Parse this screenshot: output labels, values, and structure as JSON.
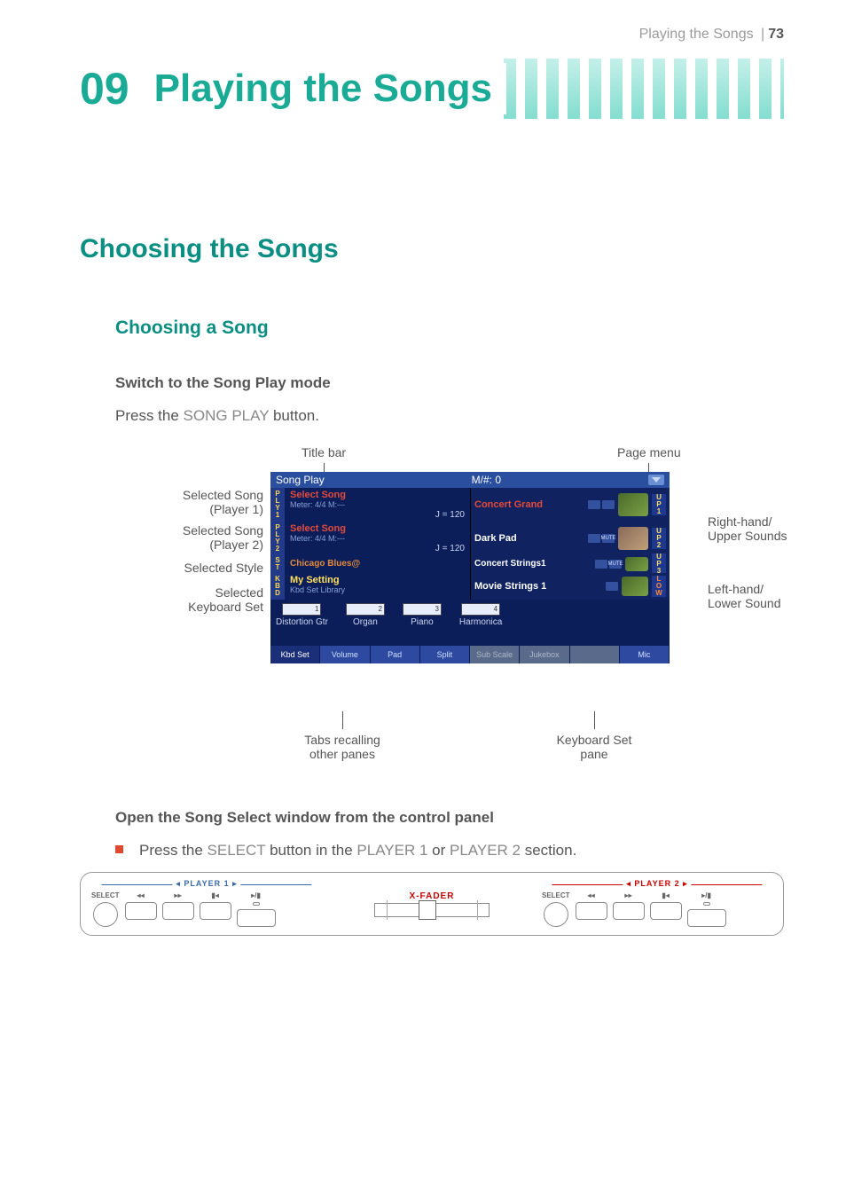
{
  "pageHeader": {
    "section": "Playing the Songs",
    "page": "73"
  },
  "chapter": {
    "num": "09",
    "title": "Playing the Songs"
  },
  "section": "Choosing the Songs",
  "subsection": "Choosing a Song",
  "lead1": "Switch to the Song Play mode",
  "para1a": "Press the ",
  "para1b": "SONG PLAY",
  "para1c": " button.",
  "callouts": {
    "titleBar": "Title bar",
    "pageMenu": "Page menu",
    "selSongP1a": "Selected Song",
    "selSongP1b": "(Player 1)",
    "selSongP2a": "Selected Song",
    "selSongP2b": "(Player 2)",
    "selStyle": "Selected Style",
    "selKbdA": "Selected",
    "selKbdB": "Keyboard Set",
    "rhA": "Right-hand/",
    "rhB": "Upper Sounds",
    "lhA": "Left-hand/",
    "lhB": "Lower Sound",
    "tabsA": "Tabs recalling",
    "tabsB": "other panes",
    "kbdPaneA": "Keyboard Set",
    "kbdPaneB": "pane"
  },
  "screen": {
    "title": "Song Play",
    "counter": "M/#: 0",
    "ply1": {
      "side": "PLY1",
      "title": "Select Song",
      "meter": "Meter: 4/4    M:---",
      "tempo": "J = 120"
    },
    "ply2": {
      "side": "PLY2",
      "title": "Select Song",
      "meter": "Meter: 4/4    M:---",
      "tempo": "J = 120"
    },
    "style": {
      "side": "ST",
      "name": "Chicago Blues@"
    },
    "kbdset": {
      "side": "KBD",
      "title": "My Setting",
      "sub": "Kbd Set Library"
    },
    "sounds": {
      "up1": "Concert Grand",
      "up1tag": "UP1",
      "up2": "Dark Pad",
      "up2tag": "UP2",
      "mute": "MUTE",
      "up3": "Concert Strings1",
      "up3tag": "UP3",
      "low": "Movie Strings 1",
      "lowtag": "LOW"
    },
    "kbdItems": {
      "k1n": "1",
      "k1": "Distortion Gtr",
      "k2n": "2",
      "k2": "Organ",
      "k3n": "3",
      "k3": "Piano",
      "k4n": "4",
      "k4": "Harmonica"
    },
    "tabs": {
      "t1": "Kbd Set",
      "t2": "Volume",
      "t3": "Pad",
      "t4": "Split",
      "t5": "Sub Scale",
      "t6": "Jukebox",
      "t7": "",
      "t8": "Mic"
    }
  },
  "lead2": "Open the Song Select window from the control panel",
  "bullet1a": "Press the ",
  "bullet1b": "SELECT",
  "bullet1c": " button in the ",
  "bullet1d": "PLAYER 1",
  "bullet1e": " or ",
  "bullet1f": "PLAYER 2",
  "bullet1g": " section.",
  "panel": {
    "p1": "PLAYER 1",
    "p2": "PLAYER 2",
    "select": "SELECT",
    "xfader": "X-FADER",
    "rew": "◂◂",
    "ff": "▸▸",
    "home": "▮◂",
    "play": "▸/▮"
  }
}
